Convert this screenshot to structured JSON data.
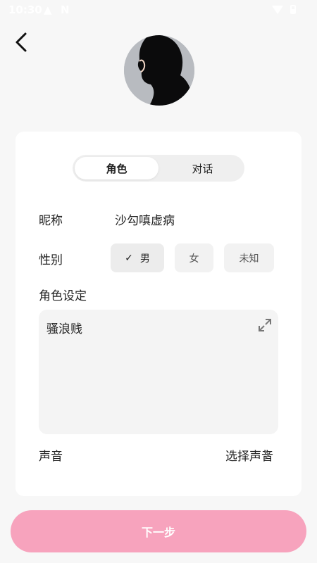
{
  "status_bar": {
    "time": "10:30",
    "warn_icon": "warning-icon",
    "n_icon": "nfc-icon"
  },
  "role_form": {
    "tabs": [
      {
        "label": "角色",
        "active": true
      },
      {
        "label": "对话",
        "active": false
      }
    ],
    "nickname": {
      "label": "昵称",
      "value": "沙勾嗔虚病"
    },
    "gender": {
      "label": "性别",
      "options": [
        {
          "label": "男",
          "selected": true
        },
        {
          "label": "女",
          "selected": false
        },
        {
          "label": "未知",
          "selected": false
        }
      ]
    },
    "role_setting": {
      "label": "角色设定",
      "value": "骚浪贱"
    },
    "voice": {
      "label": "声音",
      "value": "选择声音"
    }
  },
  "next_button": {
    "label": "下一步"
  },
  "colors": {
    "accent": "#f7a3bd",
    "background": "#f7f7f7",
    "card": "#ffffff"
  },
  "icons": {
    "back": "back-arrow-icon",
    "check": "check-icon",
    "expand": "expand-icon",
    "chevron": "chevron-right-icon"
  }
}
